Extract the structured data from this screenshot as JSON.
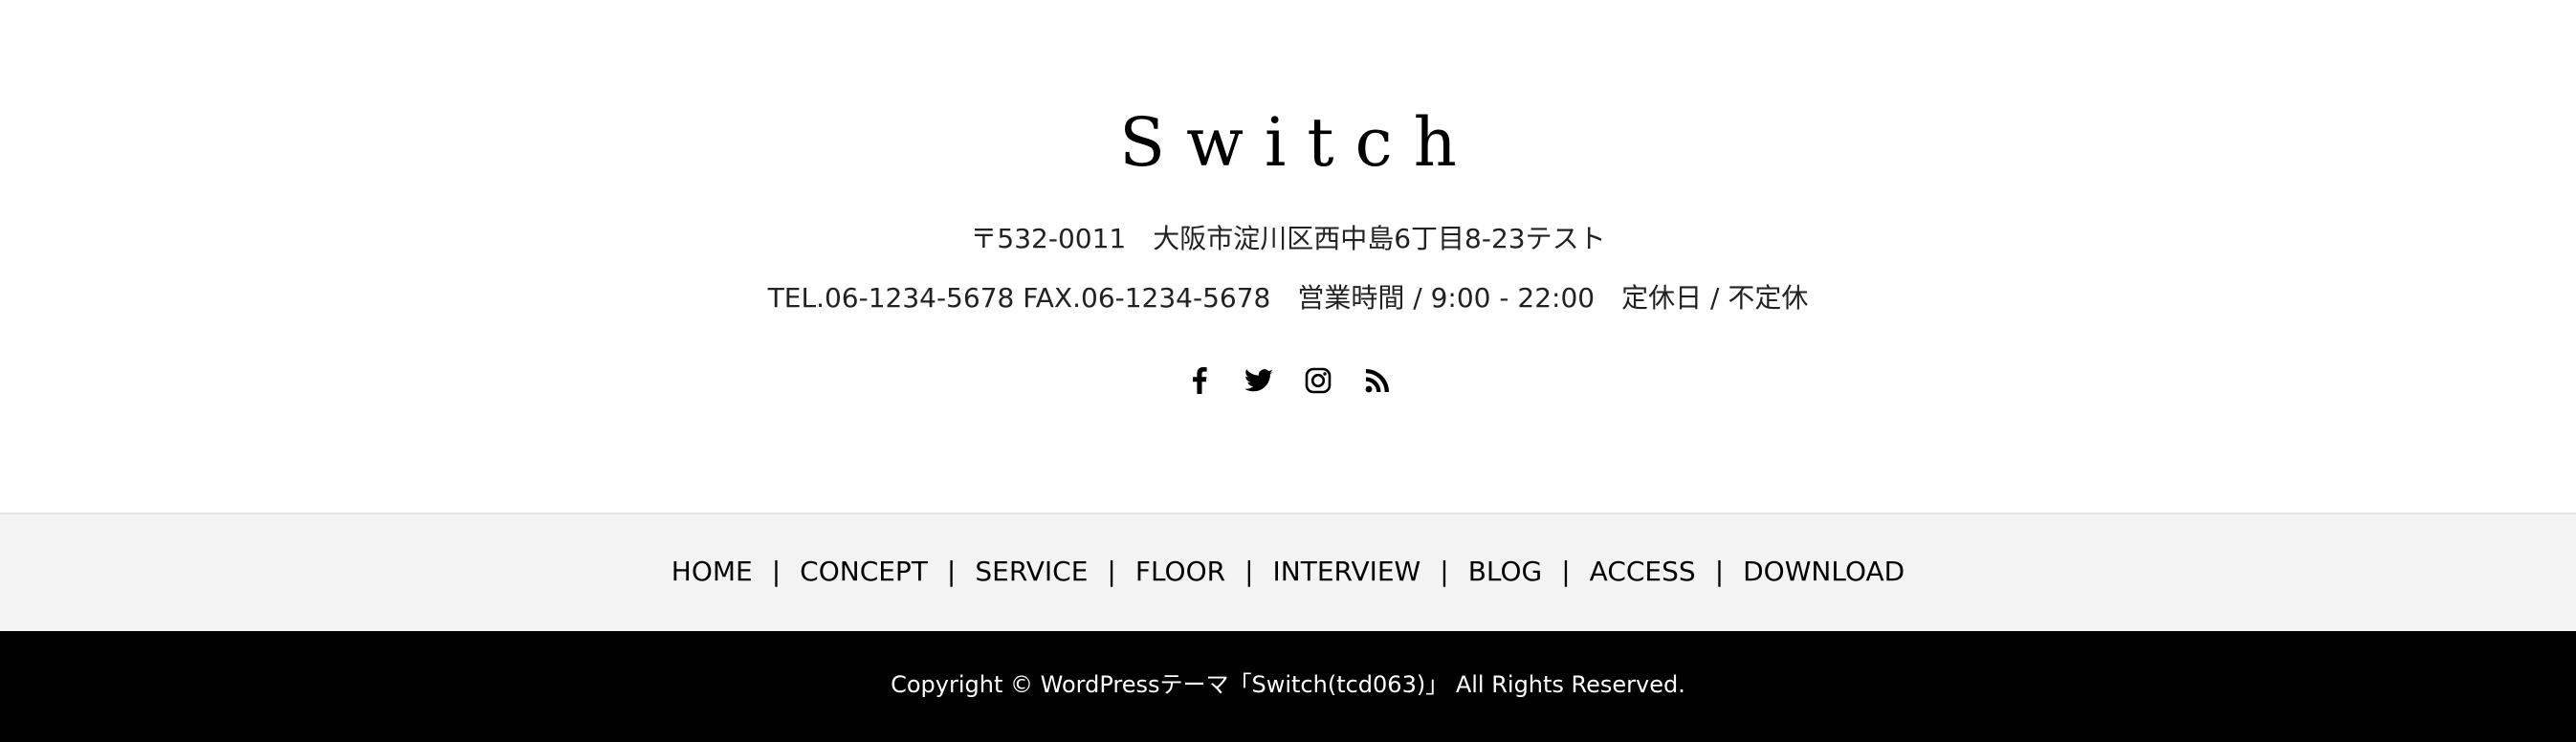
{
  "site": {
    "logo": "Switch"
  },
  "contact": {
    "postal": "〒532-0011",
    "address": "大阪市淀川区西中島6丁目8-23テスト",
    "tel": "TEL.06-1234-5678",
    "fax": "FAX.06-1234-5678",
    "hours": "営業時間 / 9:00 - 22:00",
    "holiday": "定休日 / 不定休"
  },
  "social": {
    "facebook_icon": "facebook-icon",
    "twitter_icon": "twitter-icon",
    "instagram_icon": "instagram-icon",
    "rss_icon": "rss-icon"
  },
  "nav": {
    "items": [
      {
        "label": "HOME"
      },
      {
        "label": "CONCEPT"
      },
      {
        "label": "SERVICE"
      },
      {
        "label": "FLOOR"
      },
      {
        "label": "INTERVIEW"
      },
      {
        "label": "BLOG"
      },
      {
        "label": "ACCESS"
      },
      {
        "label": "DOWNLOAD"
      }
    ],
    "separator": "|"
  },
  "footer": {
    "copyright": "Copyright © WordPressテーマ「Switch(tcd063)」 All Rights Reserved."
  },
  "colors": {
    "nav_background": "#f3f3f3",
    "copyright_background": "#000000",
    "copyright_text": "#ffffff"
  }
}
